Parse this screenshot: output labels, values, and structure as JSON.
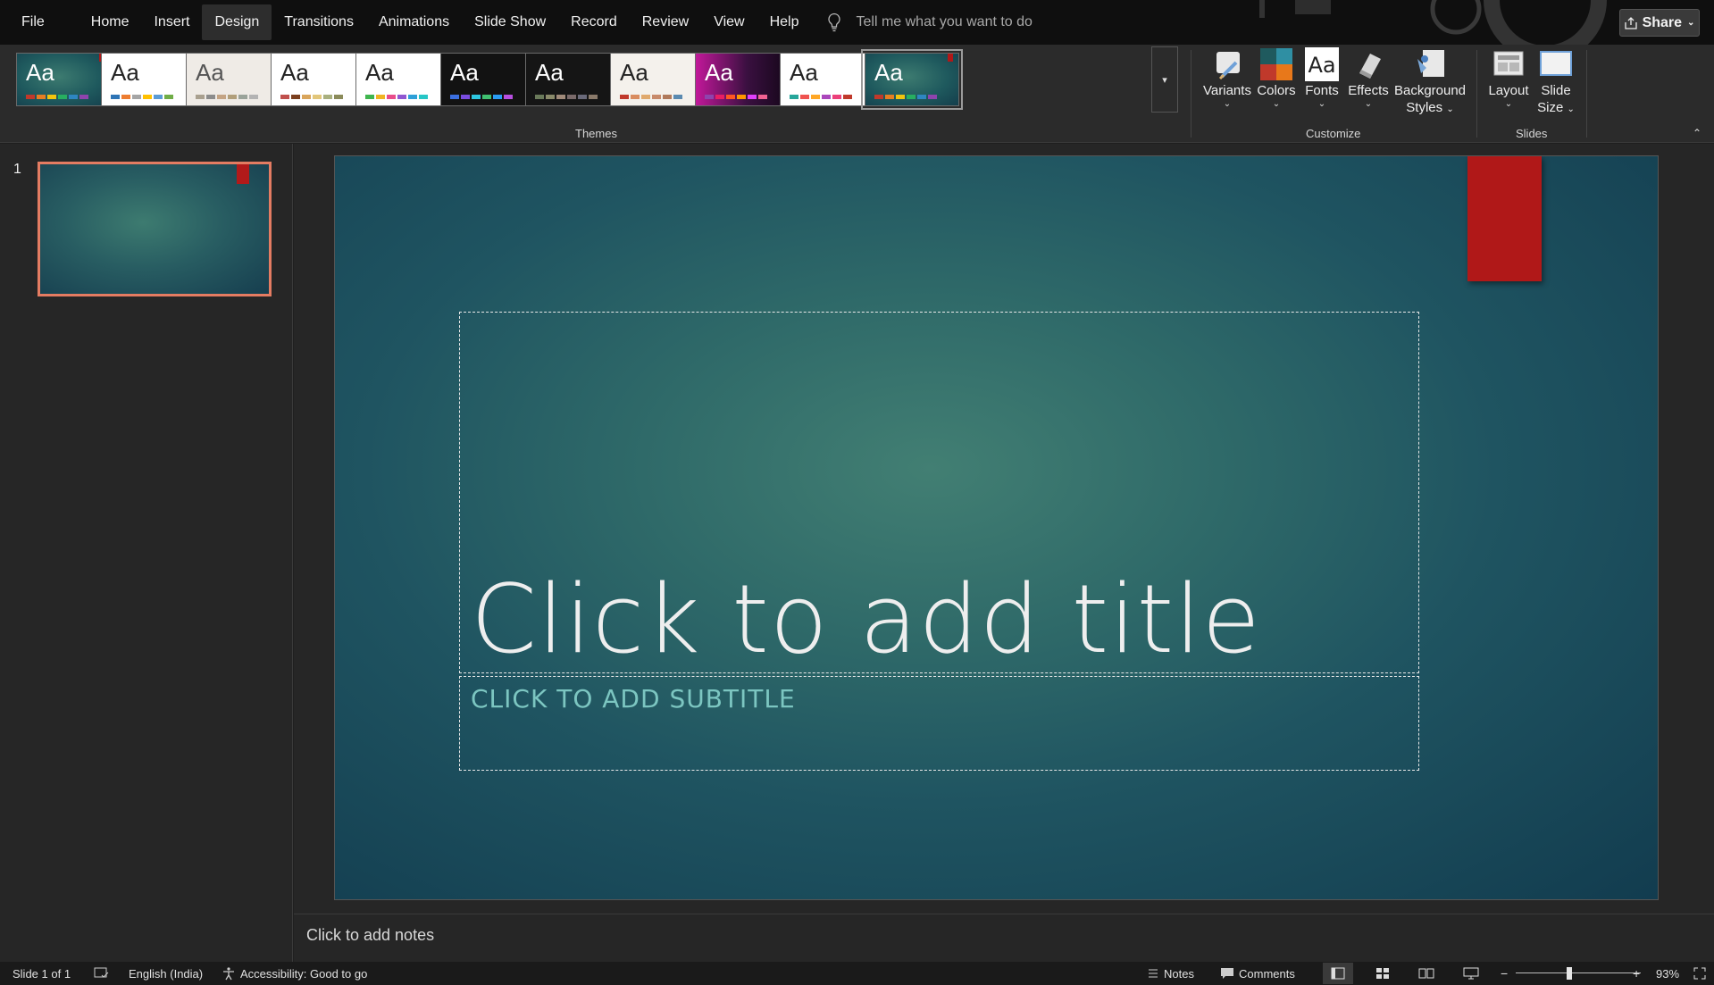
{
  "menubar": {
    "items": [
      "File",
      "Home",
      "Insert",
      "Design",
      "Transitions",
      "Animations",
      "Slide Show",
      "Record",
      "Review",
      "View",
      "Help"
    ],
    "active": "Design",
    "tell_me_placeholder": "Tell me what you want to do",
    "share_label": "Share"
  },
  "ribbon": {
    "themes_label": "Themes",
    "customize_label": "Customize",
    "slides_label": "Slides",
    "theme_aa": "Aa",
    "themes": [
      {
        "bg": "#1f5a5e",
        "fg": "#ffffff",
        "bars": [
          "#c0392b",
          "#e67e22",
          "#f1c40f",
          "#27ae60",
          "#2e86c1",
          "#8e44ad"
        ]
      },
      {
        "bg": "#ffffff",
        "fg": "#222222",
        "bars": [
          "#2e75b6",
          "#ed7d31",
          "#a5a5a5",
          "#ffc000",
          "#5b9bd5",
          "#70ad47"
        ]
      },
      {
        "bg": "#efebe6",
        "fg": "#555555",
        "bars": [
          "#a9a08f",
          "#8c8c8c",
          "#c4a484",
          "#b19f7b",
          "#9aa39a",
          "#b3b3b3"
        ]
      },
      {
        "bg": "#ffffff",
        "fg": "#222222",
        "bars": [
          "#c0504d",
          "#7b3f1e",
          "#d9a55b",
          "#e2c67a",
          "#a9b07f",
          "#8b8b5a"
        ]
      },
      {
        "bg": "#ffffff",
        "fg": "#222222",
        "bars": [
          "#3fb54f",
          "#f0b323",
          "#e84c8b",
          "#8f57d1",
          "#2ea0d8",
          "#26c6c6"
        ]
      },
      {
        "bg": "#121212",
        "fg": "#ffffff",
        "bars": [
          "#3b6fe0",
          "#7a4de0",
          "#2dc7e0",
          "#40c070",
          "#2a9df4",
          "#b84fe0"
        ]
      },
      {
        "bg": "#151515",
        "fg": "#ffffff",
        "bars": [
          "#6a7a5a",
          "#8a8a6a",
          "#a08a7a",
          "#7a6a6a",
          "#6a6a7a",
          "#8a7a6a"
        ]
      },
      {
        "bg": "#f4f1ec",
        "fg": "#222222",
        "bars": [
          "#c0392b",
          "#d98c5f",
          "#e0a96d",
          "#c88b6b",
          "#b07a5b",
          "#5a8ab0"
        ]
      },
      {
        "bg": "#3a1040",
        "fg": "#ffffff",
        "bars": [
          "#8e44ad",
          "#e91e63",
          "#ff5722",
          "#ff9800",
          "#e040fb",
          "#f06292"
        ]
      },
      {
        "bg": "#ffffff",
        "fg": "#222222",
        "bars": [
          "#26a69a",
          "#ef5350",
          "#ffa726",
          "#ab47bc",
          "#ec407a",
          "#c0392b"
        ]
      },
      {
        "bg": "#1f5a5e",
        "fg": "#ffffff",
        "bars": [
          "#c0392b",
          "#e67e22",
          "#f1c40f",
          "#27ae60",
          "#2e86c1",
          "#8e44ad"
        ]
      }
    ],
    "customize": [
      {
        "label": "Variants",
        "icon": "variants-icon"
      },
      {
        "label": "Colors",
        "icon": "colors-icon"
      },
      {
        "label": "Fonts",
        "icon": "fonts-icon"
      },
      {
        "label": "Effects",
        "icon": "effects-icon"
      },
      {
        "label_line1": "Background",
        "label_line2": "Styles",
        "icon": "background-styles-icon"
      }
    ],
    "slides_group": {
      "layout_label": "Layout",
      "slide_size_line1": "Slide",
      "slide_size_line2": "Size"
    }
  },
  "thumbnails": {
    "slide_number": "1"
  },
  "slide": {
    "title_placeholder": "Click to add title",
    "subtitle_placeholder": "CLICK TO ADD SUBTITLE"
  },
  "notes": {
    "placeholder": "Click to add notes"
  },
  "statusbar": {
    "slide_info": "Slide 1 of 1",
    "language": "English (India)",
    "accessibility": "Accessibility: Good to go",
    "notes_label": "Notes",
    "comments_label": "Comments",
    "zoom_percent": "93%",
    "zoom_level": 0.93
  },
  "colors": {
    "accent_selection": "#e47c62",
    "bookmark_red": "#b01818",
    "subtitle_teal": "#7cc6c1"
  }
}
